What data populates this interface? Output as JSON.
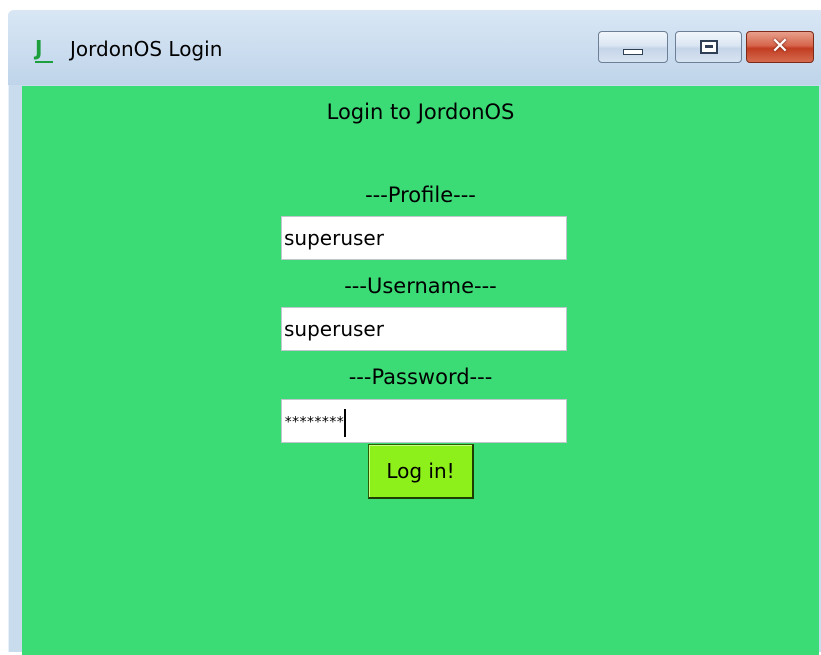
{
  "window": {
    "title": "JordonOS Login",
    "icon": "J",
    "controls": {
      "minimize": "minimize-icon",
      "maximize": "maximize-icon",
      "close": "close-icon"
    }
  },
  "form": {
    "heading": "Login to JordonOS",
    "profile_label": "---Profile---",
    "profile_value": "superuser",
    "username_label": "---Username---",
    "username_value": "superuser",
    "password_label": "---Password---",
    "password_value": "********",
    "login_button": "Log in!"
  },
  "colors": {
    "background": "#3bdb76",
    "button": "#8df01b",
    "close": "#c23d22"
  }
}
